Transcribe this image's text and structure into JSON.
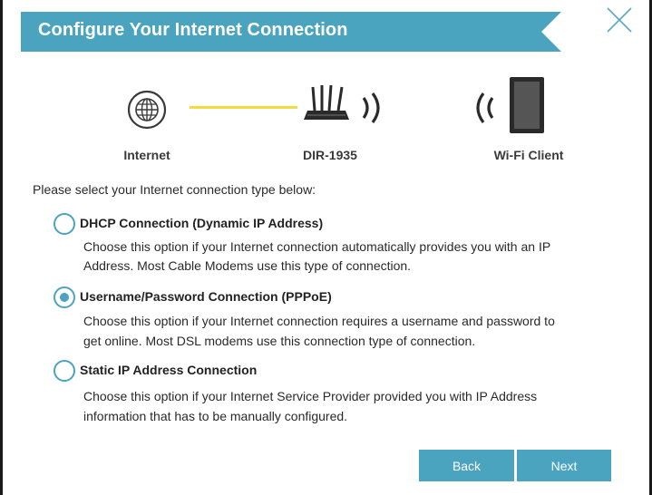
{
  "header": {
    "title": "Configure Your Internet Connection"
  },
  "colors": {
    "accent": "#4aa3bf",
    "link_line": "#f2dc3c"
  },
  "topology": {
    "nodes": [
      {
        "label": "Internet",
        "icon": "globe-icon"
      },
      {
        "label": "DIR-1935",
        "icon": "router-icon"
      },
      {
        "label": "Wi-Fi Client",
        "icon": "tablet-icon"
      }
    ]
  },
  "intro": "Please select your Internet connection type below:",
  "options": [
    {
      "title": "DHCP Connection (Dynamic IP Address)",
      "desc1": "Choose this option if your Internet connection automatically provides you with an IP",
      "desc2": "Address. Most Cable Modems use this type of connection.",
      "selected": false
    },
    {
      "title": "Username/Password Connection (PPPoE)",
      "desc1": "Choose this option if your Internet connection requires a username and password to",
      "desc2": "get online. Most DSL modems use this connection type of connection.",
      "selected": true
    },
    {
      "title": "Static IP Address Connection",
      "desc1": "Choose this option if your Internet Service Provider provided you with IP Address",
      "desc2": "information that has to be manually configured.",
      "selected": false
    }
  ],
  "buttons": {
    "back": "Back",
    "next": "Next"
  }
}
